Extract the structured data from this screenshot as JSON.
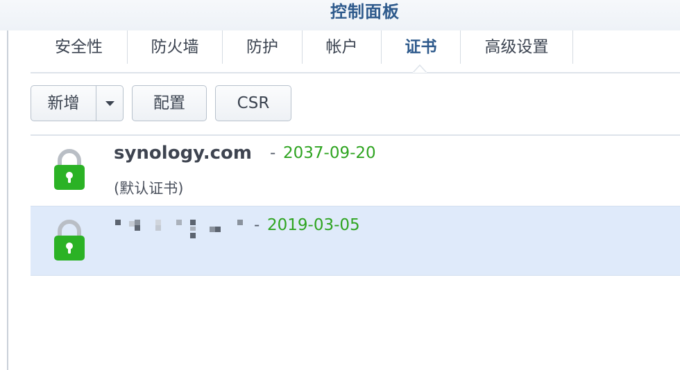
{
  "window": {
    "title": "控制面板"
  },
  "tabs": [
    {
      "label": "安全性",
      "active": false
    },
    {
      "label": "防火墙",
      "active": false
    },
    {
      "label": "防护",
      "active": false
    },
    {
      "label": "帐户",
      "active": false
    },
    {
      "label": "证书",
      "active": true
    },
    {
      "label": "高级设置",
      "active": false
    }
  ],
  "toolbar": {
    "add_label": "新增",
    "configure_label": "配置",
    "csr_label": "CSR"
  },
  "certificates": [
    {
      "name": "synology.com",
      "separator": "-",
      "expiry": "2037-09-20",
      "note": "(默认证书)",
      "selected": false
    },
    {
      "name": "",
      "name_redacted": true,
      "separator": "-",
      "expiry": "2019-03-05",
      "selected": true
    }
  ],
  "colors": {
    "title": "#2e5a8c",
    "active_tab": "#2e5a8c",
    "expiry_green": "#2ea420",
    "lock_green": "#2bb225",
    "selected_row": "#dfeafa"
  },
  "icons": {
    "lock": "lock-icon",
    "dropdown": "caret-down-icon"
  }
}
